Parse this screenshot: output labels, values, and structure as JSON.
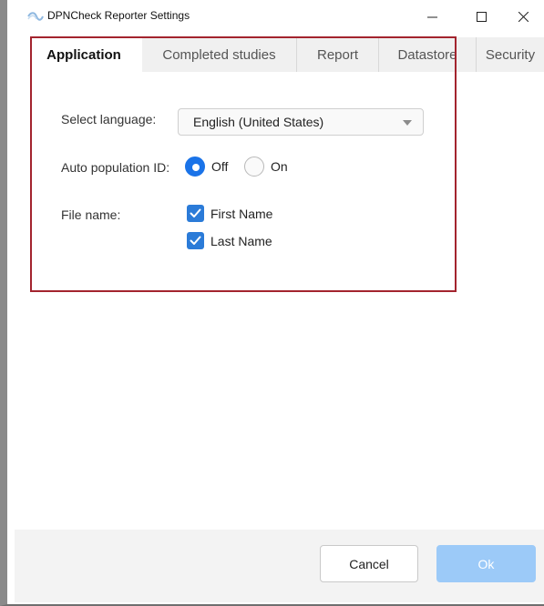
{
  "window": {
    "title": "DPNCheck Reporter Settings",
    "icon": "app-logo-icon",
    "controls": {
      "minimize": "minimize-icon",
      "maximize": "maximize-icon",
      "close": "close-icon"
    }
  },
  "tabs": [
    {
      "label": "Application",
      "active": true
    },
    {
      "label": "Completed studies",
      "active": false
    },
    {
      "label": "Report",
      "active": false
    },
    {
      "label": "Datastore",
      "active": false
    },
    {
      "label": "Security",
      "active": false
    }
  ],
  "application": {
    "language": {
      "label": "Select language:",
      "value": "English (United States)"
    },
    "auto_population": {
      "label": "Auto population ID:",
      "options": [
        {
          "label": "Off",
          "selected": true
        },
        {
          "label": "On",
          "selected": false
        }
      ]
    },
    "file_name": {
      "label": "File name:",
      "options": [
        {
          "label": "First Name",
          "checked": true
        },
        {
          "label": "Last Name",
          "checked": true
        }
      ]
    }
  },
  "footer": {
    "cancel_label": "Cancel",
    "ok_label": "Ok"
  },
  "colors": {
    "accent": "#1a73e8",
    "highlight_border": "#a3242e",
    "ok_disabled": "#9ccaf8"
  }
}
